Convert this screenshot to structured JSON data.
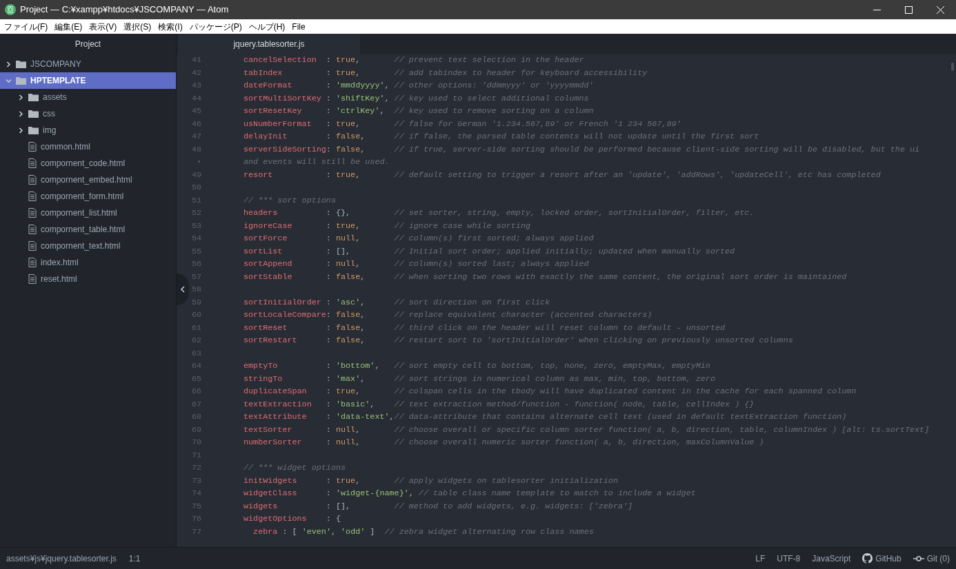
{
  "window": {
    "title": "Project — C:¥xampp¥htdocs¥JSCOMPANY — Atom"
  },
  "menu": [
    "ファイル(F)",
    "編集(E)",
    "表示(V)",
    "選択(S)",
    "検索(I)",
    "パッケージ(P)",
    "ヘルプ(H)",
    "File"
  ],
  "sidebar": {
    "title": "Project",
    "tree": [
      {
        "name": "JSCOMPANY",
        "kind": "folder",
        "expanded": false,
        "selected": false
      },
      {
        "name": "HPTEMPLATE",
        "kind": "folder",
        "expanded": true,
        "selected": true,
        "children": [
          {
            "name": "assets",
            "kind": "folder",
            "expanded": false,
            "selected": false
          },
          {
            "name": "css",
            "kind": "folder",
            "expanded": false,
            "selected": false
          },
          {
            "name": "img",
            "kind": "folder",
            "expanded": false,
            "selected": false
          },
          {
            "name": "common.html",
            "kind": "file",
            "selected": false
          },
          {
            "name": "compornent_code.html",
            "kind": "file",
            "selected": false
          },
          {
            "name": "compornent_embed.html",
            "kind": "file",
            "selected": false
          },
          {
            "name": "compornent_form.html",
            "kind": "file",
            "selected": false
          },
          {
            "name": "compornent_list.html",
            "kind": "file",
            "selected": false
          },
          {
            "name": "compornent_table.html",
            "kind": "file",
            "selected": false
          },
          {
            "name": "compornent_text.html",
            "kind": "file",
            "selected": false
          },
          {
            "name": "index.html",
            "kind": "file",
            "selected": false
          },
          {
            "name": "reset.html",
            "kind": "file",
            "selected": false
          }
        ]
      }
    ]
  },
  "tabs": [
    {
      "label": "jquery.tablesorter.js",
      "selected": true
    }
  ],
  "editor": {
    "lines": [
      {
        "kind": "pair",
        "n": "41",
        "key": "cancelSelection",
        "sep": ": ",
        "value": {
          "text": "true",
          "kind": "bool"
        },
        "comma": ",",
        "comment": "// prevent text selection in the header"
      },
      {
        "kind": "pair",
        "n": "42",
        "key": "tabIndex",
        "sep": ": ",
        "value": {
          "text": "true",
          "kind": "bool"
        },
        "comma": ",",
        "comment": "// add tabindex to header for keyboard accessibility"
      },
      {
        "kind": "pair",
        "n": "43",
        "key": "dateFormat",
        "sep": ": ",
        "value": {
          "text": "'mmddyyyy'",
          "kind": "string"
        },
        "comma": ",",
        "comment": "// other options: 'ddmmyyy' or 'yyyymmdd'"
      },
      {
        "kind": "pair",
        "n": "44",
        "key": "sortMultiSortKey",
        "sep": ": ",
        "value": {
          "text": "'shiftKey'",
          "kind": "string"
        },
        "comma": ",",
        "comment": "// key used to select additional columns"
      },
      {
        "kind": "pair",
        "n": "45",
        "key": "sortResetKey",
        "sep": ": ",
        "value": {
          "text": "'ctrlKey'",
          "kind": "string"
        },
        "comma": ",",
        "comment": "// key used to remove sorting on a column"
      },
      {
        "kind": "pair",
        "n": "46",
        "key": "usNumberFormat",
        "sep": ": ",
        "value": {
          "text": "true",
          "kind": "bool"
        },
        "comma": ",",
        "comment": "// false for German '1.234.567,89' or French '1 234 567,89'"
      },
      {
        "kind": "pair",
        "n": "47",
        "key": "delayInit",
        "sep": ": ",
        "value": {
          "text": "false",
          "kind": "bool"
        },
        "comma": ",",
        "comment": "// if false, the parsed table contents will not update until the first sort"
      },
      {
        "kind": "pair",
        "n": "48",
        "key": "serverSideSorting",
        "sep": ": ",
        "value": {
          "text": "false",
          "kind": "bool"
        },
        "comma": ",",
        "comment": "// if true, server-side sorting should be performed because client-side sorting will be disabled, but the ui"
      },
      {
        "kind": "wrap",
        "n": "•",
        "text": "and events will still be used."
      },
      {
        "kind": "pair",
        "n": "49",
        "key": "resort",
        "sep": ": ",
        "value": {
          "text": "true",
          "kind": "bool"
        },
        "comma": ",",
        "comment": "// default setting to trigger a resort after an 'update', 'addRows', 'updateCell', etc has completed"
      },
      {
        "kind": "blank",
        "n": "50"
      },
      {
        "kind": "comment",
        "n": "51",
        "text": "// *** sort options"
      },
      {
        "kind": "pair",
        "n": "52",
        "key": "headers",
        "sep": ": ",
        "value": {
          "text": "{}",
          "kind": "plain"
        },
        "comma": ",",
        "comment": "// set sorter, string, empty, locked order, sortInitialOrder, filter, etc."
      },
      {
        "kind": "pair",
        "n": "53",
        "key": "ignoreCase",
        "sep": ": ",
        "value": {
          "text": "true",
          "kind": "bool"
        },
        "comma": ",",
        "comment": "// ignore case while sorting"
      },
      {
        "kind": "pair",
        "n": "54",
        "key": "sortForce",
        "sep": ": ",
        "value": {
          "text": "null",
          "kind": "bool"
        },
        "comma": ",",
        "comment": "// column(s) first sorted; always applied"
      },
      {
        "kind": "pair",
        "n": "55",
        "key": "sortList",
        "sep": ": ",
        "value": {
          "text": "[]",
          "kind": "plain"
        },
        "comma": ",",
        "comment": "// Initial sort order; applied initially; updated when manually sorted"
      },
      {
        "kind": "pair",
        "n": "56",
        "key": "sortAppend",
        "sep": ": ",
        "value": {
          "text": "null",
          "kind": "bool"
        },
        "comma": ",",
        "comment": "// column(s) sorted last; always applied"
      },
      {
        "kind": "pair",
        "n": "57",
        "key": "sortStable",
        "sep": ": ",
        "value": {
          "text": "false",
          "kind": "bool"
        },
        "comma": ",",
        "comment": "// when sorting two rows with exactly the same content, the original sort order is maintained"
      },
      {
        "kind": "blank",
        "n": "58"
      },
      {
        "kind": "pair",
        "n": "59",
        "key": "sortInitialOrder",
        "sep": ": ",
        "value": {
          "text": "'asc'",
          "kind": "string"
        },
        "comma": ",",
        "comment": "// sort direction on first click"
      },
      {
        "kind": "pair",
        "n": "60",
        "key": "sortLocaleCompare",
        "sep": ": ",
        "value": {
          "text": "false",
          "kind": "bool"
        },
        "comma": ",",
        "comment": "// replace equivalent character (accented characters)"
      },
      {
        "kind": "pair",
        "n": "61",
        "key": "sortReset",
        "sep": ": ",
        "value": {
          "text": "false",
          "kind": "bool"
        },
        "comma": ",",
        "comment": "// third click on the header will reset column to default - unsorted"
      },
      {
        "kind": "pair",
        "n": "62",
        "key": "sortRestart",
        "sep": ": ",
        "value": {
          "text": "false",
          "kind": "bool"
        },
        "comma": ",",
        "comment": "// restart sort to 'sortInitialOrder' when clicking on previously unsorted columns"
      },
      {
        "kind": "blank",
        "n": "63"
      },
      {
        "kind": "pair",
        "n": "64",
        "key": "emptyTo",
        "sep": ": ",
        "value": {
          "text": "'bottom'",
          "kind": "string"
        },
        "comma": ",",
        "comment": "// sort empty cell to bottom, top, none, zero, emptyMax, emptyMin"
      },
      {
        "kind": "pair",
        "n": "65",
        "key": "stringTo",
        "sep": ": ",
        "value": {
          "text": "'max'",
          "kind": "string"
        },
        "comma": ",",
        "comment": "// sort strings in numerical column as max, min, top, bottom, zero"
      },
      {
        "kind": "pair",
        "n": "66",
        "key": "duplicateSpan",
        "sep": ": ",
        "value": {
          "text": "true",
          "kind": "bool"
        },
        "comma": ",",
        "comment": "// colspan cells in the tbody will have duplicated content in the cache for each spanned column"
      },
      {
        "kind": "pair",
        "n": "67",
        "key": "textExtraction",
        "sep": ": ",
        "value": {
          "text": "'basic'",
          "kind": "string"
        },
        "comma": ",",
        "comment": "// text extraction method/function - function( node, table, cellIndex ) {}"
      },
      {
        "kind": "pair",
        "n": "68",
        "key": "textAttribute",
        "sep": ": ",
        "value": {
          "text": "'data-text'",
          "kind": "string"
        },
        "comma": ",",
        "comment": "// data-attribute that contains alternate cell text (used in default textExtraction function)"
      },
      {
        "kind": "pair",
        "n": "69",
        "key": "textSorter",
        "sep": ": ",
        "value": {
          "text": "null",
          "kind": "bool"
        },
        "comma": ",",
        "comment": "// choose overall or specific column sorter function( a, b, direction, table, columnIndex ) [alt: ts.sortText]"
      },
      {
        "kind": "pair",
        "n": "70",
        "key": "numberSorter",
        "sep": ": ",
        "value": {
          "text": "null",
          "kind": "bool"
        },
        "comma": ",",
        "comment": "// choose overall numeric sorter function( a, b, direction, maxColumnValue )"
      },
      {
        "kind": "blank",
        "n": "71"
      },
      {
        "kind": "comment",
        "n": "72",
        "text": "// *** widget options"
      },
      {
        "kind": "pair",
        "n": "73",
        "key": "initWidgets",
        "sep": ": ",
        "value": {
          "text": "true",
          "kind": "bool"
        },
        "comma": ",",
        "comment": "// apply widgets on tablesorter initialization"
      },
      {
        "kind": "pair",
        "n": "74",
        "key": "widgetClass",
        "sep": ": ",
        "value": {
          "text": "'widget-{name}'",
          "kind": "string"
        },
        "comma": ",",
        "comment": "// table class name template to match to include a widget"
      },
      {
        "kind": "pair",
        "n": "75",
        "key": "widgets",
        "sep": ": ",
        "value": {
          "text": "[]",
          "kind": "plain"
        },
        "comma": ",",
        "comment": "// method to add widgets, e.g. widgets: ['zebra']"
      },
      {
        "kind": "pair",
        "n": "76",
        "key": "widgetOptions",
        "sep": ": ",
        "value": {
          "text": "{",
          "kind": "plain"
        }
      },
      {
        "kind": "raw",
        "n": "77",
        "tokens": [
          {
            "kind": "key",
            "t": "  zebra"
          },
          {
            "kind": "plain",
            "t": " : [ "
          },
          {
            "kind": "string",
            "t": "'even'"
          },
          {
            "kind": "plain",
            "t": ", "
          },
          {
            "kind": "string",
            "t": "'odd'"
          },
          {
            "kind": "plain",
            "t": " ]  "
          },
          {
            "kind": "comment",
            "t": "// zebra widget alternating row class names"
          }
        ]
      }
    ]
  },
  "status_bar": {
    "path": "assets¥js¥jquery.tablesorter.js",
    "cursor": "1:1",
    "line_ending": "LF",
    "encoding": "UTF-8",
    "grammar": "JavaScript",
    "github": "GitHub",
    "git": "Git (0)"
  }
}
